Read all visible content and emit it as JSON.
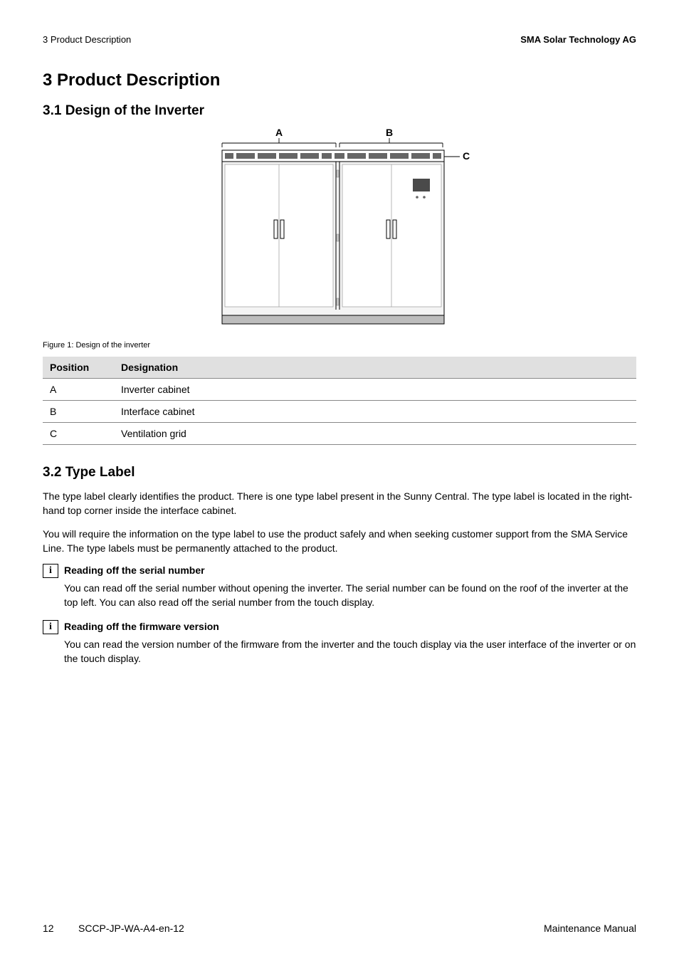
{
  "header": {
    "left": "3  Product Description",
    "right": "SMA Solar Technology AG"
  },
  "h1": "3  Product Description",
  "section_3_1": {
    "title": "3.1   Design of the Inverter",
    "figure_labels": {
      "A": "A",
      "B": "B",
      "C": "C"
    },
    "caption": "Figure 1:   Design of the inverter",
    "table": {
      "headers": [
        "Position",
        "Designation"
      ],
      "rows": [
        [
          "A",
          "Inverter cabinet"
        ],
        [
          "B",
          "Interface cabinet"
        ],
        [
          "C",
          "Ventilation grid"
        ]
      ]
    }
  },
  "section_3_2": {
    "title": "3.2   Type Label",
    "p1": "The type label clearly identifies the product. There is one type label present in the Sunny Central. The type label is located in the right-hand top corner inside the interface cabinet.",
    "p2": "You will require the information on the type label to use the product safely and when seeking customer support from the SMA Service Line. The type labels must be permanently attached to the product.",
    "info1": {
      "title": "Reading off the serial number",
      "body": "You can read off the serial number without opening the inverter. The serial number can be found on the roof of the inverter at the top left. You can also read off the serial number from the touch display."
    },
    "info2": {
      "title": "Reading off the firmware version",
      "body": "You can read the version number of the firmware from the inverter and the touch display via the user interface of the inverter or on the touch display."
    }
  },
  "footer": {
    "page": "12",
    "code": "SCCP-JP-WA-A4-en-12",
    "right": "Maintenance Manual"
  },
  "chart_data": {
    "type": "diagram",
    "title": "Design of the inverter",
    "annotations": [
      {
        "label": "A",
        "designation": "Inverter cabinet",
        "region": "left cabinet body"
      },
      {
        "label": "B",
        "designation": "Interface cabinet",
        "region": "right cabinet body"
      },
      {
        "label": "C",
        "designation": "Ventilation grid",
        "region": "top horizontal louvered strip across both cabinets"
      }
    ],
    "description": "Front-view line drawing of a two-compartment inverter enclosure. A wider left cabinet (A) and narrower right cabinet (B) share a common top horizontal ventilation grid (C). Both cabinets have vertical door handles; the right cabinet has a small dark display/panel with two indicator dots in its upper-right area. A thin base plinth runs along the bottom."
  }
}
